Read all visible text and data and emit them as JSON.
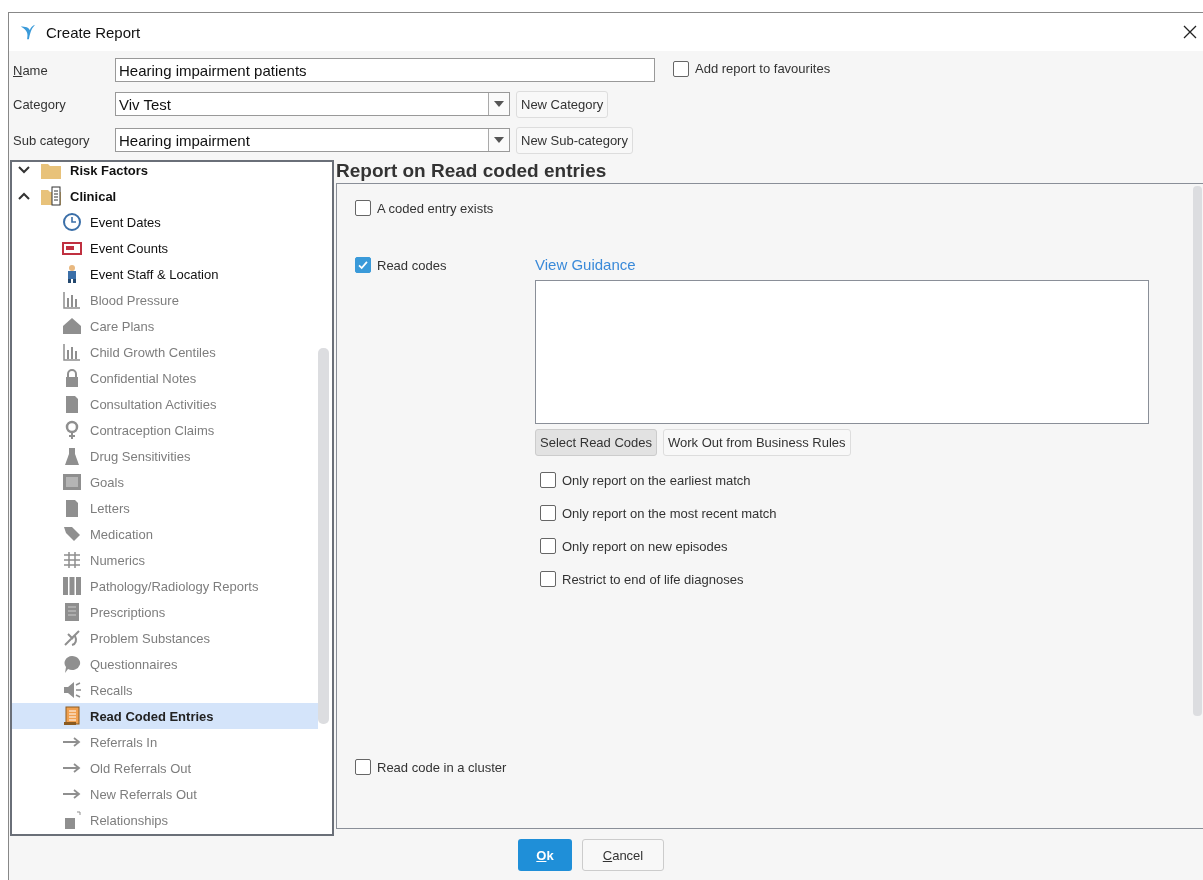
{
  "window": {
    "title": "Create Report"
  },
  "form": {
    "name": {
      "label": "Name",
      "value": "Hearing impairment patients"
    },
    "favourite": {
      "label": "Add report to favourites",
      "checked": false
    },
    "category": {
      "label": "Category",
      "value": "Viv Test",
      "button": "New Category"
    },
    "sub_category": {
      "label": "Sub category",
      "value": "Hearing impairment",
      "button": "New Sub-category"
    }
  },
  "tree": [
    {
      "label": "Risk Factors",
      "expanded": false
    },
    {
      "label": "Clinical",
      "expanded": true,
      "children": [
        {
          "label": "Event Dates",
          "disabled": false,
          "selected": false
        },
        {
          "label": "Event Counts",
          "disabled": false,
          "selected": false
        },
        {
          "label": "Event Staff & Location",
          "disabled": false,
          "selected": false
        },
        {
          "label": "Blood Pressure",
          "disabled": true,
          "selected": false
        },
        {
          "label": "Care Plans",
          "disabled": true,
          "selected": false
        },
        {
          "label": "Child Growth Centiles",
          "disabled": true,
          "selected": false
        },
        {
          "label": "Confidential Notes",
          "disabled": true,
          "selected": false
        },
        {
          "label": "Consultation Activities",
          "disabled": true,
          "selected": false
        },
        {
          "label": "Contraception Claims",
          "disabled": true,
          "selected": false
        },
        {
          "label": "Drug Sensitivities",
          "disabled": true,
          "selected": false
        },
        {
          "label": "Goals",
          "disabled": true,
          "selected": false
        },
        {
          "label": "Letters",
          "disabled": true,
          "selected": false
        },
        {
          "label": "Medication",
          "disabled": true,
          "selected": false
        },
        {
          "label": "Numerics",
          "disabled": true,
          "selected": false
        },
        {
          "label": "Pathology/Radiology Reports",
          "disabled": true,
          "selected": false
        },
        {
          "label": "Prescriptions",
          "disabled": true,
          "selected": false
        },
        {
          "label": "Problem Substances",
          "disabled": true,
          "selected": false
        },
        {
          "label": "Questionnaires",
          "disabled": true,
          "selected": false
        },
        {
          "label": "Recalls",
          "disabled": true,
          "selected": false
        },
        {
          "label": "Read Coded Entries",
          "disabled": false,
          "selected": true
        },
        {
          "label": "Referrals In",
          "disabled": true,
          "selected": false
        },
        {
          "label": "Old Referrals Out",
          "disabled": true,
          "selected": false
        },
        {
          "label": "New Referrals Out",
          "disabled": true,
          "selected": false
        },
        {
          "label": "Relationships",
          "disabled": true,
          "selected": false
        }
      ]
    }
  ],
  "report": {
    "title": "Report on Read coded entries",
    "coded_entry_exists": {
      "label": "A coded entry exists",
      "checked": false
    },
    "read_codes": {
      "label": "Read codes",
      "checked": true
    },
    "guidance_link": "View Guidance",
    "buttons": [
      {
        "label": "Select Read Codes",
        "selected": true
      },
      {
        "label": "Work Out from Business Rules",
        "selected": false
      }
    ],
    "options": [
      {
        "label": "Only report on the earliest match",
        "checked": false
      },
      {
        "label": "Only report on the most recent match",
        "checked": false
      },
      {
        "label": "Only report on new episodes",
        "checked": false
      },
      {
        "label": "Restrict to end of life diagnoses",
        "checked": false
      }
    ],
    "cluster": {
      "label": "Read code in a cluster",
      "checked": false
    }
  },
  "footer": {
    "ok": "Ok",
    "cancel": "Cancel"
  }
}
